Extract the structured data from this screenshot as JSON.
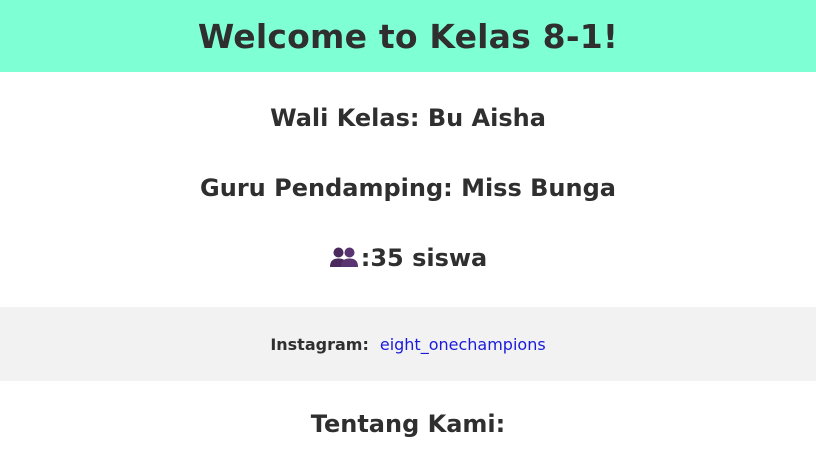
{
  "header": {
    "title": "Welcome to Kelas 8-1!",
    "background": "#7fffd4"
  },
  "info": {
    "wali_kelas": "Wali Kelas: Bu Aisha",
    "guru_pendamping": "Guru Pendamping: Miss Bunga",
    "siswa_count": ":35 siswa",
    "siswa_icon": "people-icon"
  },
  "instagram": {
    "label": "Instagram:",
    "handle": "eight_onechampions",
    "bar_color": "#f2f2f2",
    "link_color": "#1a1adb"
  },
  "about": {
    "heading": "Tentang Kami:"
  }
}
